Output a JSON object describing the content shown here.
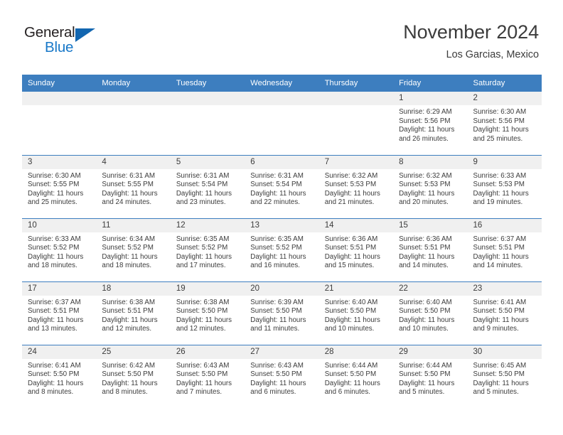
{
  "brand": {
    "name_part1": "General",
    "name_part2": "Blue",
    "triangle_color": "#1266b0",
    "blue_color": "#1878c8"
  },
  "header": {
    "month_title": "November 2024",
    "location": "Los Garcias, Mexico"
  },
  "theme": {
    "header_blue": "#3d7ebf",
    "daynum_band": "#f0f0f0",
    "text": "#3c3c3c"
  },
  "weekday_headers": [
    "Sunday",
    "Monday",
    "Tuesday",
    "Wednesday",
    "Thursday",
    "Friday",
    "Saturday"
  ],
  "weeks": [
    [
      {
        "day": "",
        "info": ""
      },
      {
        "day": "",
        "info": ""
      },
      {
        "day": "",
        "info": ""
      },
      {
        "day": "",
        "info": ""
      },
      {
        "day": "",
        "info": ""
      },
      {
        "day": "1",
        "info": "Sunrise: 6:29 AM\nSunset: 5:56 PM\nDaylight: 11 hours\nand 26 minutes."
      },
      {
        "day": "2",
        "info": "Sunrise: 6:30 AM\nSunset: 5:56 PM\nDaylight: 11 hours\nand 25 minutes."
      }
    ],
    [
      {
        "day": "3",
        "info": "Sunrise: 6:30 AM\nSunset: 5:55 PM\nDaylight: 11 hours\nand 25 minutes."
      },
      {
        "day": "4",
        "info": "Sunrise: 6:31 AM\nSunset: 5:55 PM\nDaylight: 11 hours\nand 24 minutes."
      },
      {
        "day": "5",
        "info": "Sunrise: 6:31 AM\nSunset: 5:54 PM\nDaylight: 11 hours\nand 23 minutes."
      },
      {
        "day": "6",
        "info": "Sunrise: 6:31 AM\nSunset: 5:54 PM\nDaylight: 11 hours\nand 22 minutes."
      },
      {
        "day": "7",
        "info": "Sunrise: 6:32 AM\nSunset: 5:53 PM\nDaylight: 11 hours\nand 21 minutes."
      },
      {
        "day": "8",
        "info": "Sunrise: 6:32 AM\nSunset: 5:53 PM\nDaylight: 11 hours\nand 20 minutes."
      },
      {
        "day": "9",
        "info": "Sunrise: 6:33 AM\nSunset: 5:53 PM\nDaylight: 11 hours\nand 19 minutes."
      }
    ],
    [
      {
        "day": "10",
        "info": "Sunrise: 6:33 AM\nSunset: 5:52 PM\nDaylight: 11 hours\nand 18 minutes."
      },
      {
        "day": "11",
        "info": "Sunrise: 6:34 AM\nSunset: 5:52 PM\nDaylight: 11 hours\nand 18 minutes."
      },
      {
        "day": "12",
        "info": "Sunrise: 6:35 AM\nSunset: 5:52 PM\nDaylight: 11 hours\nand 17 minutes."
      },
      {
        "day": "13",
        "info": "Sunrise: 6:35 AM\nSunset: 5:52 PM\nDaylight: 11 hours\nand 16 minutes."
      },
      {
        "day": "14",
        "info": "Sunrise: 6:36 AM\nSunset: 5:51 PM\nDaylight: 11 hours\nand 15 minutes."
      },
      {
        "day": "15",
        "info": "Sunrise: 6:36 AM\nSunset: 5:51 PM\nDaylight: 11 hours\nand 14 minutes."
      },
      {
        "day": "16",
        "info": "Sunrise: 6:37 AM\nSunset: 5:51 PM\nDaylight: 11 hours\nand 14 minutes."
      }
    ],
    [
      {
        "day": "17",
        "info": "Sunrise: 6:37 AM\nSunset: 5:51 PM\nDaylight: 11 hours\nand 13 minutes."
      },
      {
        "day": "18",
        "info": "Sunrise: 6:38 AM\nSunset: 5:51 PM\nDaylight: 11 hours\nand 12 minutes."
      },
      {
        "day": "19",
        "info": "Sunrise: 6:38 AM\nSunset: 5:50 PM\nDaylight: 11 hours\nand 12 minutes."
      },
      {
        "day": "20",
        "info": "Sunrise: 6:39 AM\nSunset: 5:50 PM\nDaylight: 11 hours\nand 11 minutes."
      },
      {
        "day": "21",
        "info": "Sunrise: 6:40 AM\nSunset: 5:50 PM\nDaylight: 11 hours\nand 10 minutes."
      },
      {
        "day": "22",
        "info": "Sunrise: 6:40 AM\nSunset: 5:50 PM\nDaylight: 11 hours\nand 10 minutes."
      },
      {
        "day": "23",
        "info": "Sunrise: 6:41 AM\nSunset: 5:50 PM\nDaylight: 11 hours\nand 9 minutes."
      }
    ],
    [
      {
        "day": "24",
        "info": "Sunrise: 6:41 AM\nSunset: 5:50 PM\nDaylight: 11 hours\nand 8 minutes."
      },
      {
        "day": "25",
        "info": "Sunrise: 6:42 AM\nSunset: 5:50 PM\nDaylight: 11 hours\nand 8 minutes."
      },
      {
        "day": "26",
        "info": "Sunrise: 6:43 AM\nSunset: 5:50 PM\nDaylight: 11 hours\nand 7 minutes."
      },
      {
        "day": "27",
        "info": "Sunrise: 6:43 AM\nSunset: 5:50 PM\nDaylight: 11 hours\nand 6 minutes."
      },
      {
        "day": "28",
        "info": "Sunrise: 6:44 AM\nSunset: 5:50 PM\nDaylight: 11 hours\nand 6 minutes."
      },
      {
        "day": "29",
        "info": "Sunrise: 6:44 AM\nSunset: 5:50 PM\nDaylight: 11 hours\nand 5 minutes."
      },
      {
        "day": "30",
        "info": "Sunrise: 6:45 AM\nSunset: 5:50 PM\nDaylight: 11 hours\nand 5 minutes."
      }
    ]
  ]
}
